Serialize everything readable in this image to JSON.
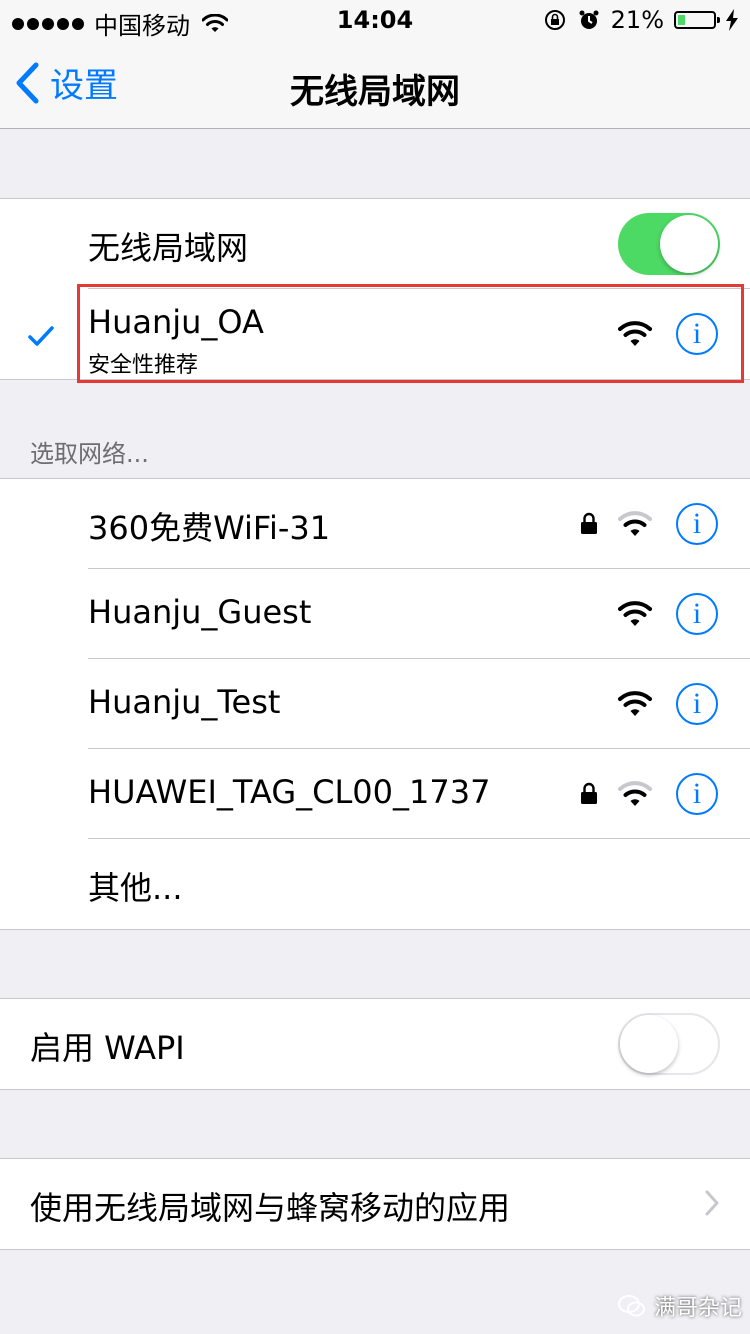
{
  "status_bar": {
    "carrier": "中国移动",
    "time": "14:04",
    "battery": "21%",
    "battery_level": 0.21
  },
  "nav": {
    "back_label": "设置",
    "title": "无线局域网"
  },
  "wifi_toggle": {
    "label": "无线局域网",
    "on": true
  },
  "connected": {
    "name": "Huanju_OA",
    "subtitle": "安全性推荐",
    "info": "i"
  },
  "section_header": "选取网络...",
  "networks": [
    {
      "name": "360免费WiFi-31",
      "secured": true,
      "signal": "weak",
      "info": "i"
    },
    {
      "name": "Huanju_Guest",
      "secured": false,
      "signal": "full",
      "info": "i"
    },
    {
      "name": "Huanju_Test",
      "secured": false,
      "signal": "full",
      "info": "i"
    },
    {
      "name": "HUAWEI_TAG_CL00_1737",
      "secured": true,
      "signal": "weak",
      "info": "i"
    }
  ],
  "other_label": "其他...",
  "wapi": {
    "label": "启用 WAPI",
    "on": false
  },
  "apps_link": {
    "label": "使用无线局域网与蜂窝移动的应用"
  },
  "watermark": "满哥杂记",
  "colors": {
    "accent": "#007aff",
    "toggle_on": "#4cd964",
    "highlight": "#e53935",
    "background": "#efeff4"
  }
}
